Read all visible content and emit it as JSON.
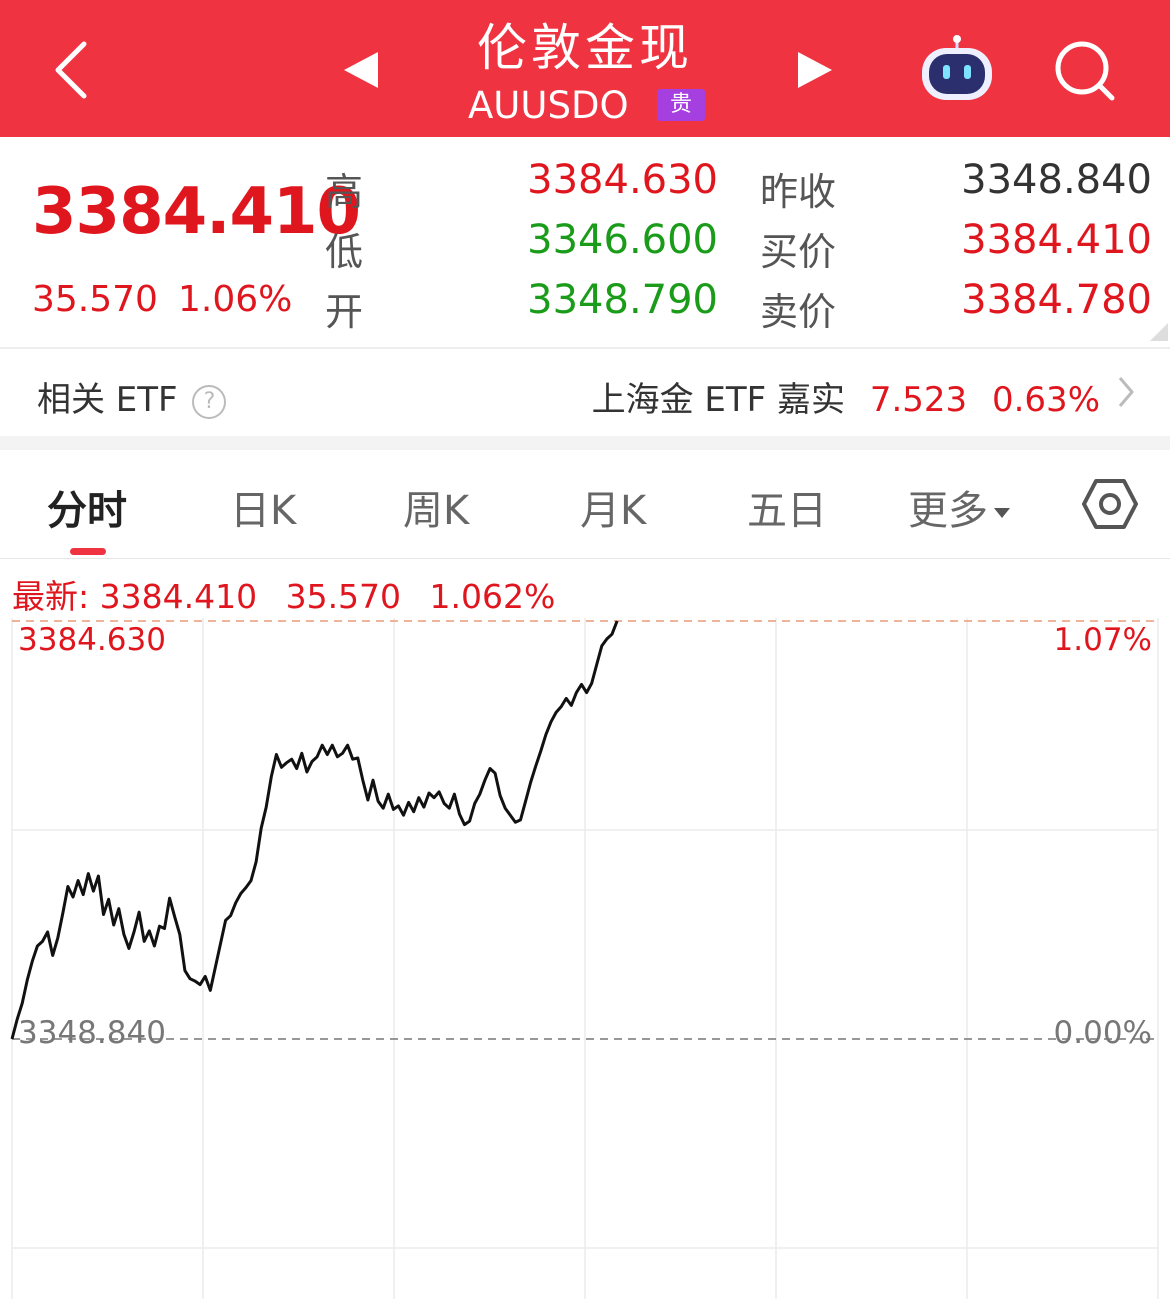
{
  "header": {
    "title": "伦敦金现",
    "subtitle": "AUUSDO",
    "badge": "贵"
  },
  "quote": {
    "price": "3384.410",
    "change": "35.570",
    "change_pct": "1.06%",
    "labels": {
      "high": "高",
      "low": "低",
      "open": "开",
      "prev_close": "昨收",
      "bid": "买价",
      "ask": "卖价"
    },
    "high": "3384.630",
    "low": "3346.600",
    "open": "3348.790",
    "prev_close": "3348.840",
    "bid": "3384.410",
    "ask": "3384.780"
  },
  "etf": {
    "label": "相关 ETF",
    "help_icon": "?",
    "name": "上海金 ETF 嘉实",
    "price": "7.523",
    "pct": "0.63%"
  },
  "tabs": {
    "items": [
      "分时",
      "日K",
      "周K",
      "月K",
      "五日"
    ],
    "more": "更多",
    "active_index": 0
  },
  "chart_data": {
    "type": "line",
    "latest_label": "最新: 3384.410",
    "latest_change": "35.570",
    "latest_pct": "1.062%",
    "y_top_label": "3384.630",
    "y_top_pct": "1.07%",
    "y_base_label": "3348.840",
    "y_base_pct": "0.00%",
    "ylim": [
      3348.84,
      3384.63
    ],
    "y": [
      3348.84,
      3350.5,
      3351.9,
      3353.9,
      3355.5,
      3356.8,
      3357.2,
      3358.0,
      3356.0,
      3357.5,
      3359.6,
      3361.9,
      3361.0,
      3362.4,
      3361.2,
      3363.0,
      3361.5,
      3362.8,
      3359.5,
      3360.8,
      3358.6,
      3360.0,
      3357.8,
      3356.6,
      3358.0,
      3359.7,
      3357.2,
      3358.1,
      3356.8,
      3358.5,
      3358.3,
      3360.9,
      3359.3,
      3357.8,
      3354.7,
      3354.0,
      3353.8,
      3353.5,
      3354.2,
      3353.0,
      3355.0,
      3357.0,
      3359.0,
      3359.4,
      3360.5,
      3361.3,
      3361.8,
      3362.4,
      3364.0,
      3366.9,
      3368.7,
      3371.3,
      3373.2,
      3372.1,
      3372.5,
      3372.8,
      3372.0,
      3373.3,
      3371.7,
      3372.6,
      3373.0,
      3374.0,
      3373.2,
      3374.0,
      3373.0,
      3373.3,
      3374.0,
      3372.8,
      3372.9,
      3371.0,
      3369.3,
      3371.0,
      3369.2,
      3368.6,
      3369.8,
      3368.5,
      3368.8,
      3368.0,
      3369.1,
      3368.3,
      3369.5,
      3368.7,
      3369.9,
      3369.5,
      3370.0,
      3369.0,
      3368.6,
      3369.8,
      3368.1,
      3367.2,
      3367.5,
      3369.0,
      3369.8,
      3371.0,
      3372.0,
      3371.6,
      3369.7,
      3368.6,
      3368.0,
      3367.4,
      3367.6,
      3369.2,
      3370.8,
      3372.2,
      3373.5,
      3374.9,
      3376.0,
      3376.8,
      3377.3,
      3378.0,
      3377.4,
      3378.5,
      3379.2,
      3378.5,
      3379.3,
      3380.9,
      3382.5,
      3383.1,
      3383.5,
      3384.63
    ],
    "x_gridlines": 6,
    "y_gridlines": 4
  },
  "icons": {
    "back": "chevron-left-icon",
    "prev": "triangle-left-icon",
    "next": "triangle-right-icon",
    "assistant": "robot-icon",
    "search": "search-icon",
    "settings": "hexagon-settings-icon",
    "etf_more": "chevron-right-icon"
  },
  "colors": {
    "header_bg": "#ef3340",
    "up": "#e0161e",
    "down": "#1a9c1a",
    "badge": "#a63fe0"
  }
}
